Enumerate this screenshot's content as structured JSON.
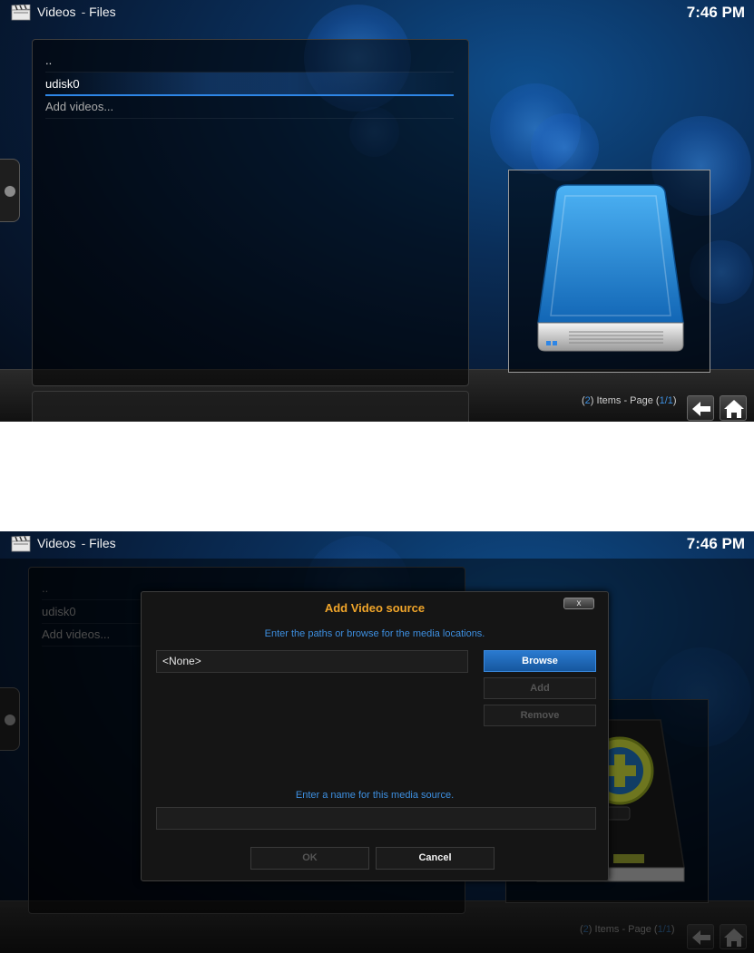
{
  "screens": [
    {
      "header": {
        "section": "Videos",
        "subsection": "Files",
        "clock": "7:46 PM"
      },
      "list": [
        {
          "label": "..",
          "state": "normal"
        },
        {
          "label": "udisk0",
          "state": "selected"
        },
        {
          "label": "Add videos...",
          "state": "dim"
        }
      ],
      "status": {
        "items": "2",
        "items_suffix": ") Items - Page (",
        "page": "1/1",
        "close": ")"
      },
      "thumbnail_icon": "hard-drive-icon"
    },
    {
      "header": {
        "section": "Videos",
        "subsection": "Files",
        "clock": "7:46 PM"
      },
      "list": [
        {
          "label": "..",
          "state": "dim"
        },
        {
          "label": "udisk0",
          "state": "dim"
        },
        {
          "label": "Add videos...",
          "state": "dim"
        }
      ],
      "status": {
        "items": "2",
        "items_suffix": ") Items - Page (",
        "page": "1/1",
        "close": ")"
      },
      "dialog": {
        "title": "Add Video source",
        "close_label": "x",
        "paths_hint": "Enter the paths or browse for the media locations.",
        "path_value": "<None>",
        "browse_label": "Browse",
        "add_label": "Add",
        "remove_label": "Remove",
        "name_hint": "Enter a name for this media source.",
        "name_value": "",
        "ok_label": "OK",
        "cancel_label": "Cancel"
      },
      "thumbnail_icon": "add-drive-icon"
    }
  ],
  "colors": {
    "accent_blue": "#3d8fe0",
    "dialog_title": "#f0a52a",
    "focus_button": "#1f6cbf"
  }
}
